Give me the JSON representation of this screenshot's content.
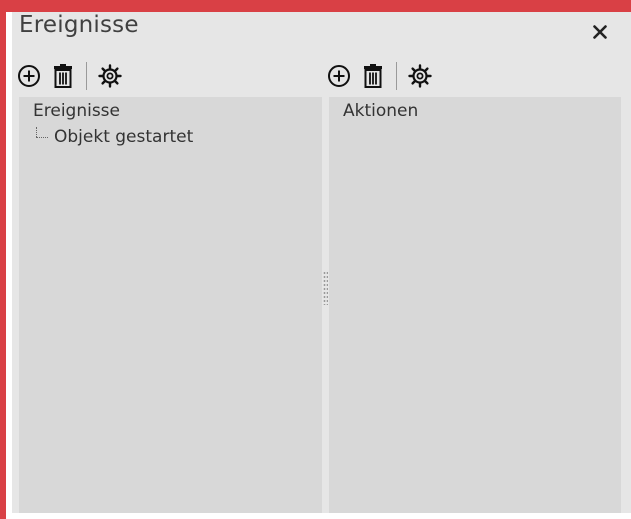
{
  "window": {
    "title": "Ereignisse",
    "accent_color": "#d94045",
    "close_icon": "close-icon"
  },
  "left_pane": {
    "toolbar": {
      "add_icon": "add-circle-icon",
      "delete_icon": "trash-icon",
      "settings_icon": "gear-icon"
    },
    "header": "Ereignisse",
    "items": [
      {
        "label": "Objekt gestartet"
      }
    ]
  },
  "right_pane": {
    "toolbar": {
      "add_icon": "add-circle-icon",
      "delete_icon": "trash-icon",
      "settings_icon": "gear-icon"
    },
    "header": "Aktionen",
    "items": []
  }
}
